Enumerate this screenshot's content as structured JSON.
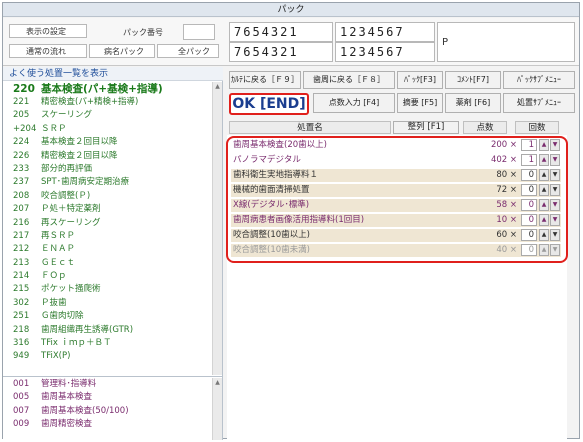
{
  "window": {
    "title": "パック"
  },
  "topbar": {
    "label_display_settings": "表示の設定",
    "label_pack_no": "パック番号",
    "label_normal_flow": "通常の流れ",
    "label_named_pack": "病名パック",
    "label_all_pack": "全パック",
    "teeth_upper": "7654321",
    "teeth_upper_right": "1234567",
    "teeth_lower": "7654321",
    "teeth_lower_right": "1234567",
    "side_label": "P"
  },
  "left_panel": {
    "header": "よく使う処置一覧を表示",
    "group_code": "220",
    "group_label": "基本検査(パ+基検+指導)",
    "items": [
      {
        "code": "221",
        "label": "精密検査(パ+精検+指導)"
      },
      {
        "code": "205",
        "label": "スケーリング"
      },
      {
        "code": "+204",
        "label": "ＳＲＰ"
      },
      {
        "code": "224",
        "label": "基本検査２回目以降"
      },
      {
        "code": "226",
        "label": "精密検査２回目以降"
      },
      {
        "code": "233",
        "label": "部分的再評価"
      },
      {
        "code": "237",
        "label": "SPT･歯周病安定期治療"
      },
      {
        "code": "208",
        "label": "咬合調整(Ｐ)"
      },
      {
        "code": "207",
        "label": "Ｐ処＋特定薬剤"
      },
      {
        "code": "216",
        "label": "再スケーリング"
      },
      {
        "code": "217",
        "label": "再ＳＲＰ"
      },
      {
        "code": "212",
        "label": "ＥＮＡＰ"
      },
      {
        "code": "213",
        "label": "ＧＥｃｔ"
      },
      {
        "code": "214",
        "label": "ＦＯｐ"
      },
      {
        "code": "215",
        "label": "ポケット掻爬術"
      },
      {
        "code": "302",
        "label": "Ｐ抜歯"
      },
      {
        "code": "251",
        "label": "Ｇ歯肉切除"
      },
      {
        "code": "218",
        "label": "歯周組織再生誘導(GTR)"
      },
      {
        "code": "316",
        "label": "TFix ｉｍｐ＋ＢＴ"
      },
      {
        "code": "949",
        "label": "TFiX(P)"
      }
    ],
    "items2": [
      {
        "code": "001",
        "label": "管理料･指導料"
      },
      {
        "code": "005",
        "label": "歯周基本検査"
      },
      {
        "code": "007",
        "label": "歯周基本検査(50/100)"
      },
      {
        "code": "009",
        "label": "歯周精密検査"
      }
    ]
  },
  "toolbar": {
    "karte_back": "ｶﾙﾃに戻る［Ｆ９］",
    "perio_back": "歯周に戻る［Ｆ８］",
    "pack": "ﾊﾟｯｸ[F3]",
    "comment": "ｺﾒﾝﾄ[F7]",
    "pack_sub_menu": "ﾊﾟｯｸｻﾌﾞﾒﾆｭｰ",
    "ok": "OK [END]",
    "points_input": "点数入力 [F4]",
    "summary": "摘要 [F5]",
    "drug": "薬剤 [F6]",
    "treatment_sub_menu": "処置ｻﾌﾞﾒﾆｭｰ"
  },
  "columns": {
    "name": "処置名",
    "sort": "整列 [F1]",
    "points": "点数",
    "count": "回数"
  },
  "treatments": [
    {
      "name": "歯周基本検査(20歯以上)",
      "points": "200",
      "qty": "1",
      "color": "#7a2c6e",
      "bg": "#ffffff"
    },
    {
      "name": "パノラマデジタル",
      "points": "402",
      "qty": "1",
      "color": "#7a2c6e",
      "bg": "#ffffff"
    },
    {
      "name": "歯科衛生実地指導料１",
      "points": "80",
      "qty": "0",
      "color": "#333333",
      "bg": "#efe6d3"
    },
    {
      "name": "機械的歯面清掃処置",
      "points": "72",
      "qty": "0",
      "color": "#333333",
      "bg": "#efe6d3"
    },
    {
      "name": "X線(デジタル･標準)",
      "points": "58",
      "qty": "0",
      "color": "#7a2c6e",
      "bg": "#efe6d3"
    },
    {
      "name": "歯周病患者画像活用指導料(1回目)",
      "points": "10",
      "qty": "0",
      "color": "#7a2c6e",
      "bg": "#efe6d3"
    },
    {
      "name": "咬合調整(10歯以上)",
      "points": "60",
      "qty": "0",
      "color": "#333333",
      "bg": "#efe6d3"
    },
    {
      "name": "咬合調整(10歯未満)",
      "points": "40",
      "qty": "0",
      "color": "#9a9a9a",
      "bg": "#efe6d3"
    }
  ],
  "times_sign": "×",
  "up_arrow": "▲",
  "down_arrow": "▼",
  "accent": "#e0201c"
}
